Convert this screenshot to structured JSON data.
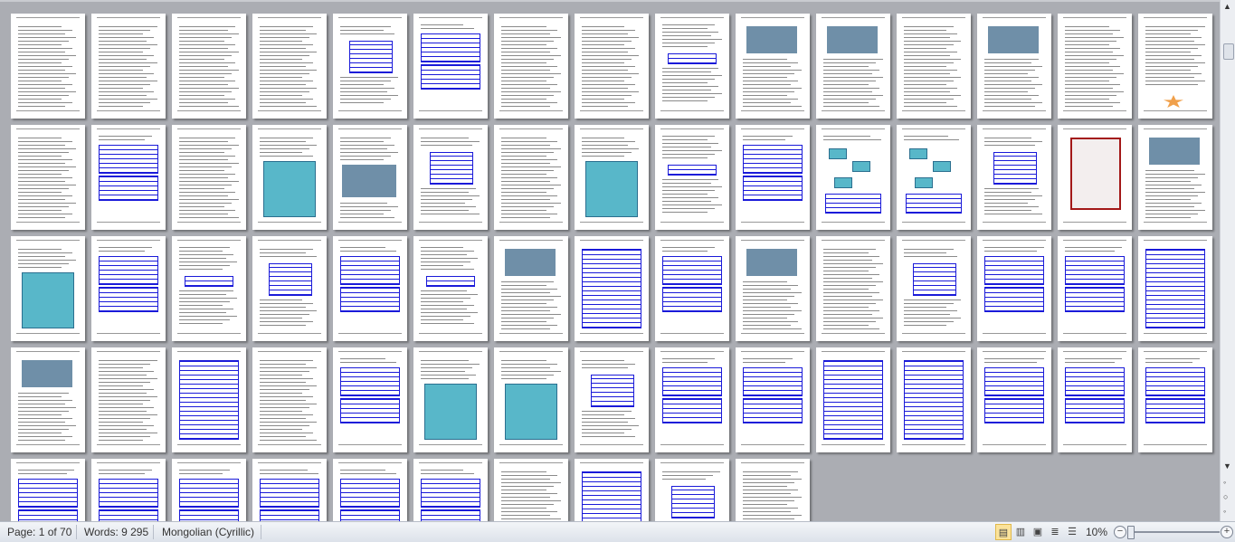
{
  "status": {
    "page": "Page: 1 of 70",
    "words": "Words: 9 295",
    "language": "Mongolian (Cyrillic)",
    "zoom": "10%",
    "zoom_percent": 10
  },
  "view_buttons": [
    "print-layout",
    "full-screen-reading",
    "web-layout",
    "outline",
    "draft"
  ],
  "colors": {
    "table_blue": "#1a1ad9",
    "background": "#abadb3",
    "status_bg": "#e7ebf1"
  },
  "icons": {
    "scroll_up": "▲",
    "scroll_down": "▼",
    "zoom_minus": "−",
    "zoom_plus": "+"
  }
}
